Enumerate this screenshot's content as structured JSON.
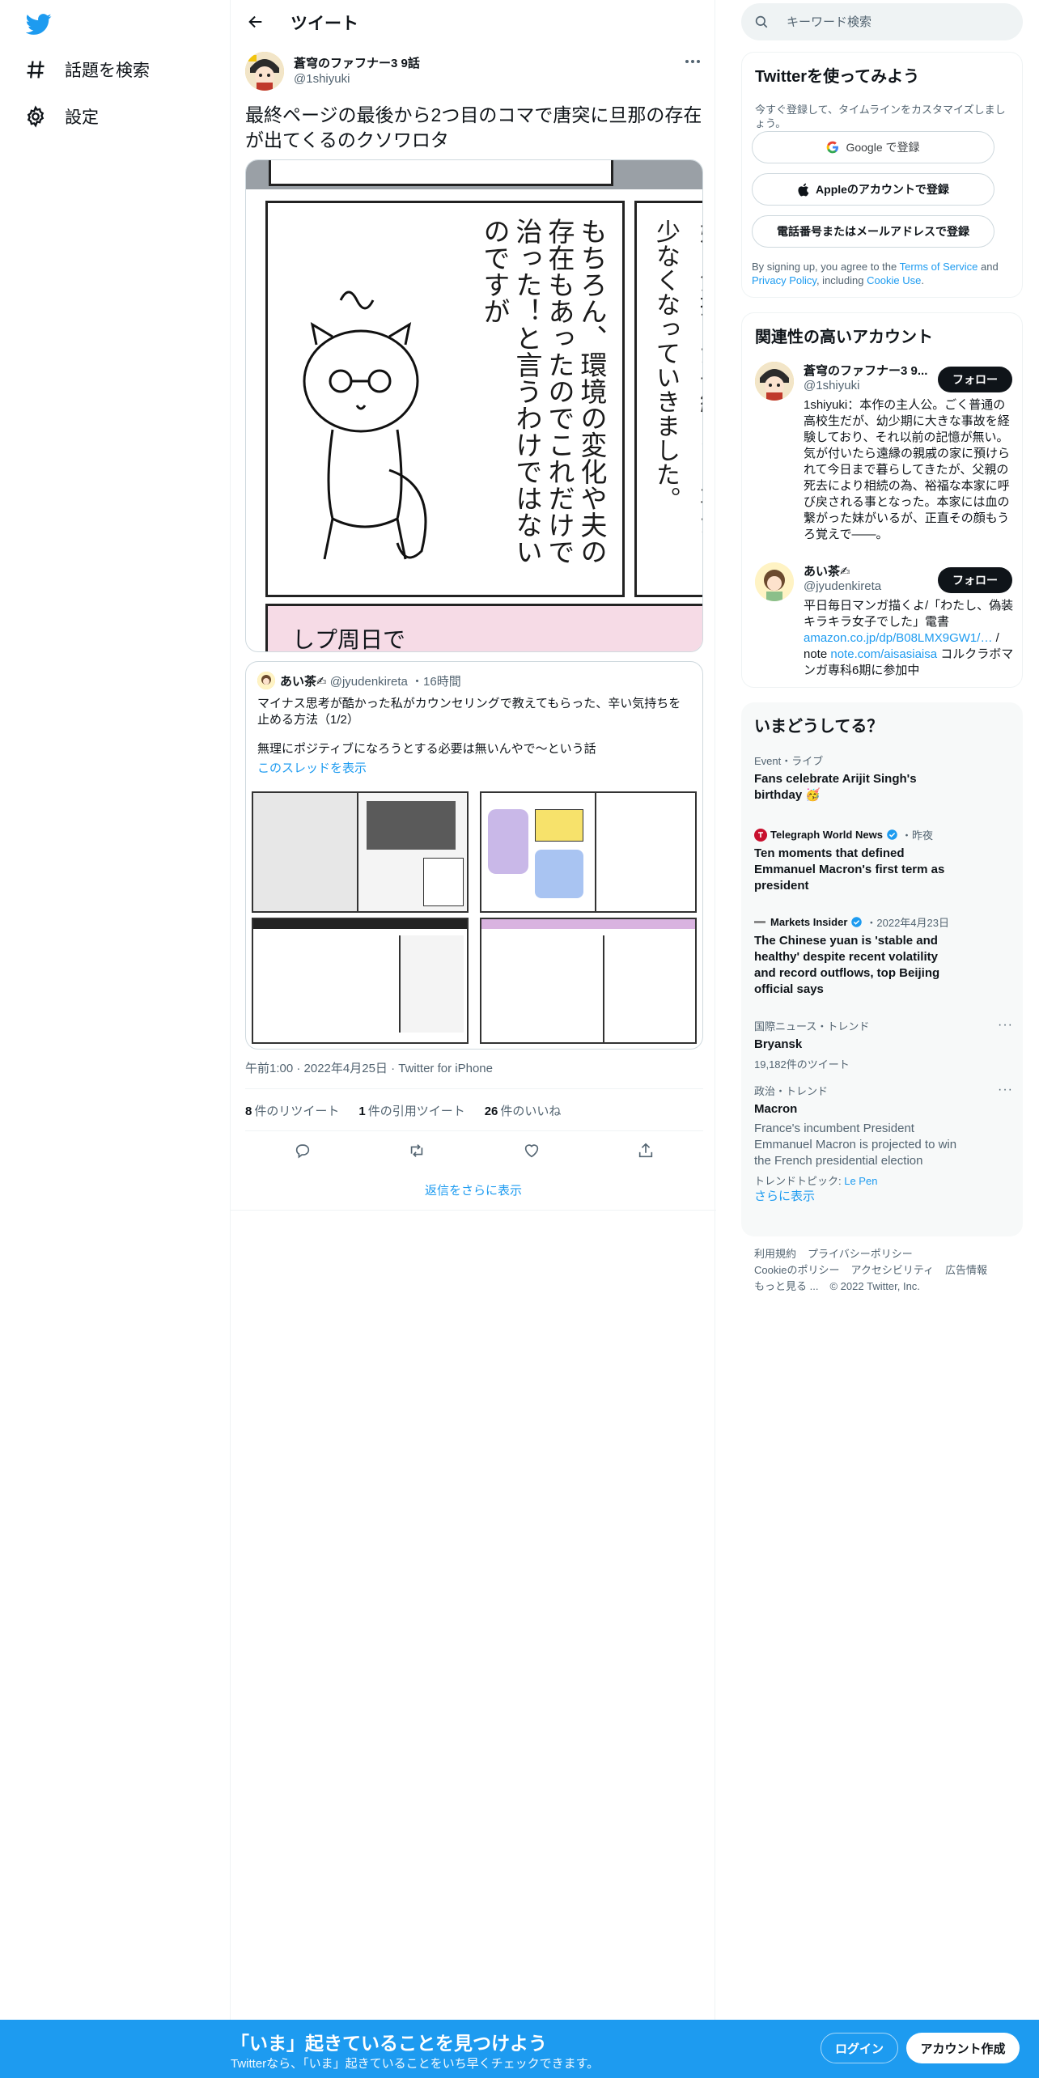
{
  "nav": {
    "explore_label": "話題を検索",
    "settings_label": "設定"
  },
  "header": {
    "title": "ツイート"
  },
  "tweet": {
    "author_name": "蒼穹のファフナー3 9話",
    "author_handle": "@1shiyuki",
    "text": "最終ページの最後から2つ目のコマで唐突に旦那の存在が出てくるのクソワロタ",
    "manga_panel_main": "もちろん、環境の変化や夫の存在もあったのでこれだけで治った！と言うわけではないのですが",
    "manga_panel_right": "少なくなっていきました。",
    "manga_panel_right_top": "嫌な気持ちが長続きする事が",
    "manga_panel_bottom": "しプ周日で",
    "timestamp": "午前1:00 · 2022年4月25日 · Twitter for iPhone",
    "retweets_count": "8",
    "retweets_label": "件のリツイート",
    "quotes_count": "1",
    "quotes_label": "件の引用ツイート",
    "likes_count": "26",
    "likes_label": "件のいいね",
    "show_more_replies": "返信をさらに表示"
  },
  "quoted": {
    "author_name": "あい茶✍",
    "author_handle": "@jyudenkireta",
    "time": "16時間",
    "text": "マイナス思考が酷かった私がカウンセリングで教えてもらった、辛い気持ちを止める方法（1/2）",
    "text2": "無理にポジティブになろうとする必要は無いんやで〜という話",
    "thread_link": "このスレッドを表示"
  },
  "search": {
    "placeholder": "キーワード検索"
  },
  "signup": {
    "title": "Twitterを使ってみよう",
    "subtitle": "今すぐ登録して、タイムラインをカスタマイズしましょう。",
    "google_label": "Google で登録",
    "apple_label": "Appleのアカウントで登録",
    "phone_label": "電話番号またはメールアドレスで登録",
    "terms_prefix": "By signing up, you agree to the ",
    "terms_link": "Terms of Service",
    "terms_and": " and ",
    "privacy_link": "Privacy Policy",
    "including": ", including ",
    "cookie_link": "Cookie Use",
    "terms_end": "."
  },
  "relevant": {
    "title": "関連性の高いアカウント",
    "accounts": [
      {
        "name": "蒼穹のファフナー3 9...",
        "handle": "@1shiyuki",
        "follow": "フォロー",
        "bio": "1shiyuki：本作の主人公。ごく普通の高校生だが、幼少期に大きな事故を経験しており、それ以前の記憶が無い。気が付いたら遠縁の親戚の家に預けられて今日まで暮らしてきたが、父親の死去により相続の為、裕福な本家に呼び戻される事となった。本家には血の繋がった妹がいるが、正直その顔もうろ覚えで――。"
      },
      {
        "name": "あい茶✍",
        "handle": "@jyudenkireta",
        "follow": "フォロー",
        "bio_1": "平日毎日マンガ描くよ/「わたし、偽装キラキラ女子でした」電書",
        "bio_link1": "amazon.co.jp/dp/B08LMX9GW1/…",
        "bio_2": " / note ",
        "bio_link2": "note.com/aisasiaisa",
        "bio_3": " コルクラボマンガ専科6期に参加中"
      }
    ]
  },
  "trends": {
    "title": "いまどうしてる？",
    "items": [
      {
        "meta": "Event・ライブ",
        "title": "Fans celebrate Arijit Singh's birthday 🥳"
      },
      {
        "source": "Telegraph World News",
        "time": "・昨夜",
        "title": "Ten moments that defined Emmanuel Macron's first term as president"
      },
      {
        "source": "Markets Insider",
        "time": "・2022年4月23日",
        "title": "The Chinese yuan is 'stable and healthy' despite recent volatility and record outflows, top Beijing official says"
      },
      {
        "meta": "国際ニュース・トレンド",
        "title": "Bryansk",
        "sub": "19,182件のツイート"
      },
      {
        "meta": "政治・トレンド",
        "title": "Macron",
        "desc": "France's incumbent President Emmanuel Macron is projected to win the French presidential election",
        "topic_prefix": "トレンドトピック: ",
        "topic_link": "Le Pen"
      }
    ],
    "show_more": "さらに表示"
  },
  "footer": {
    "links_1": [
      "利用規約",
      "プライバシーポリシー"
    ],
    "links_2": [
      "Cookieのポリシー",
      "アクセシビリティ",
      "広告情報"
    ],
    "more": "もっと見る ...",
    "copyright": "© 2022 Twitter, Inc."
  },
  "bottom_bar": {
    "title": "「いま」起きていることを見つけよう",
    "subtitle": "Twitterなら、「いま」起きていることをいち早くチェックできます。",
    "login": "ログイン",
    "signup": "アカウント作成"
  },
  "colors": {
    "accent": "#1d9bf0",
    "text": "#0f1419",
    "muted": "#536471",
    "border": "#eff3f4",
    "follow_button": "#0f1419"
  },
  "icons": {
    "logo": "twitter-bird-icon",
    "explore": "hashtag-icon",
    "settings": "gear-icon",
    "back": "arrow-left-icon",
    "search": "search-icon",
    "reply": "reply-icon",
    "retweet": "retweet-icon",
    "like": "heart-icon",
    "share": "share-icon"
  }
}
